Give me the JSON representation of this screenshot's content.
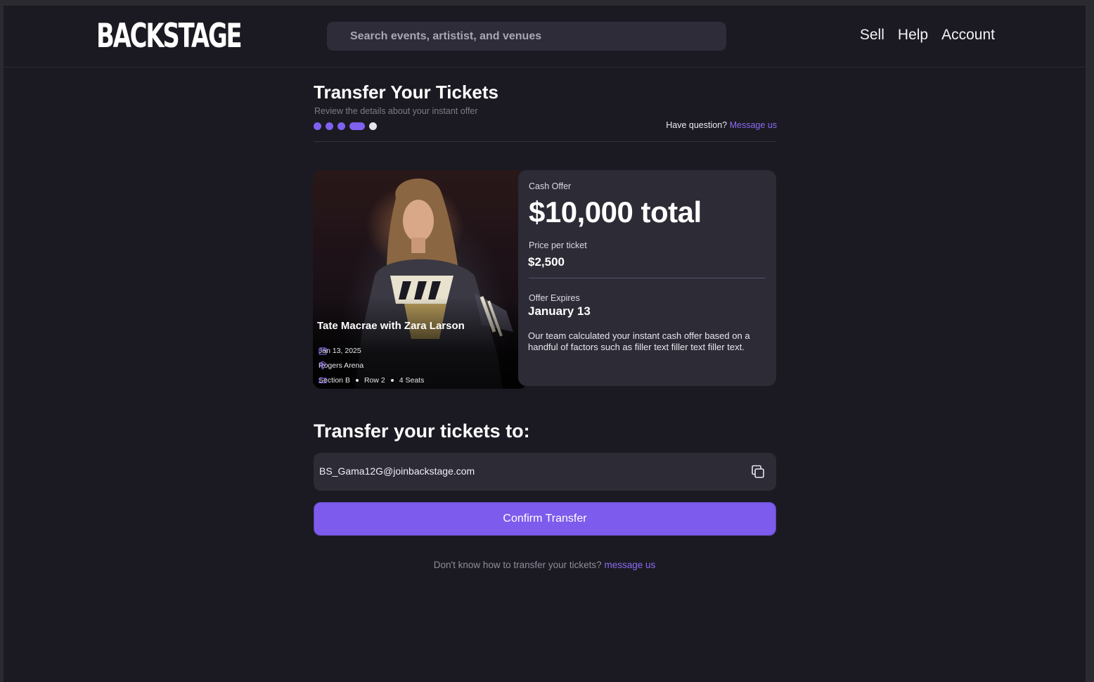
{
  "header": {
    "logo": "BACKSTAGE",
    "search_placeholder": "Search events, artistist, and venues",
    "nav": [
      "Sell",
      "Help",
      "Account"
    ]
  },
  "page": {
    "title": "Transfer Your Tickets",
    "subtitle": "Review the details about your instant offer",
    "progress": {
      "total_steps": 5,
      "current_step": 4
    },
    "question_text": "Have question?",
    "question_link": "Message us"
  },
  "event": {
    "name": "Tate Macrae with Zara Larson",
    "date": "Jan 13, 2025",
    "venue": "Rogers Arena",
    "section": "Section B",
    "row": "Row 2",
    "seats": "4 Seats"
  },
  "offer": {
    "cash_label": "Cash Offer",
    "total": "$10,000 total",
    "price_label": "Price per ticket",
    "price": "$2,500",
    "expires_label": "Offer Expires",
    "expires": "January 13",
    "description": "Our team calculated your instant cash offer based on a handful of factors such as filler text filler text filler text."
  },
  "transfer": {
    "title": "Transfer your tickets to:",
    "email": "BS_Gama12G@joinbackstage.com",
    "confirm_label": "Confirm Transfer",
    "help_text": "Don't know how to transfer your tickets?",
    "help_link": "message us"
  },
  "colors": {
    "accent": "#7d5bec",
    "link": "#8c6cf5",
    "background": "#1b1a22",
    "card": "#2c2b36"
  }
}
